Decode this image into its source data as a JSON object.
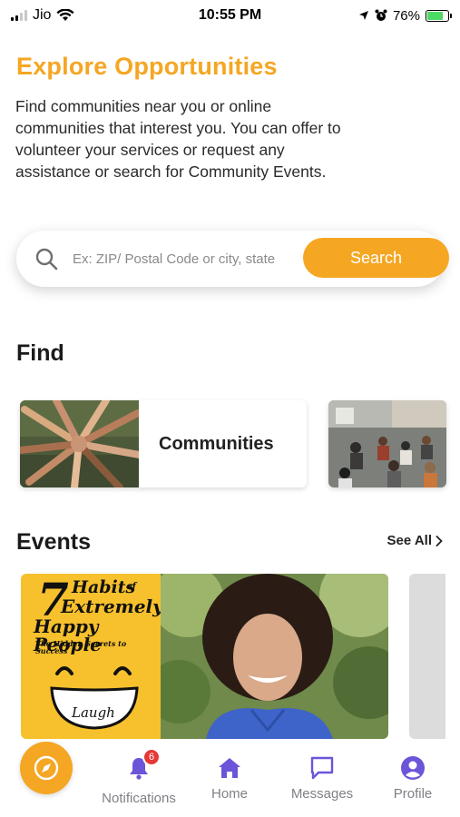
{
  "status_bar": {
    "carrier": "Jio",
    "time": "10:55 PM",
    "battery_percent": "76%",
    "battery_level": 0.76
  },
  "header": {
    "title": "Explore Opportunities",
    "subtitle": "Find communities near you or online communities that interest you. You can offer to volunteer your services or request any assistance or search for Community Events."
  },
  "search": {
    "placeholder": "Ex: ZIP/ Postal Code or city, state",
    "button_label": "Search"
  },
  "find": {
    "title": "Find",
    "cards": [
      {
        "label": "Communities"
      }
    ]
  },
  "events": {
    "title": "Events",
    "see_all_label": "See All",
    "poster": {
      "line1": "7 Habits",
      "line2": "of",
      "line3": "Extremely",
      "line4": "Happy People",
      "tagline": "The Hidden Secrets to Success",
      "bottom_word": "Laugh"
    }
  },
  "bottom_nav": {
    "items": [
      {
        "label": "Notifications",
        "badge": "6",
        "icon": "bell-icon"
      },
      {
        "label": "Home",
        "icon": "home-icon"
      },
      {
        "label": "Messages",
        "icon": "message-icon"
      },
      {
        "label": "Profile",
        "icon": "profile-icon"
      }
    ]
  },
  "colors": {
    "accent": "#f5a623",
    "nav_icon": "#6c55d9",
    "badge": "#e53935"
  }
}
